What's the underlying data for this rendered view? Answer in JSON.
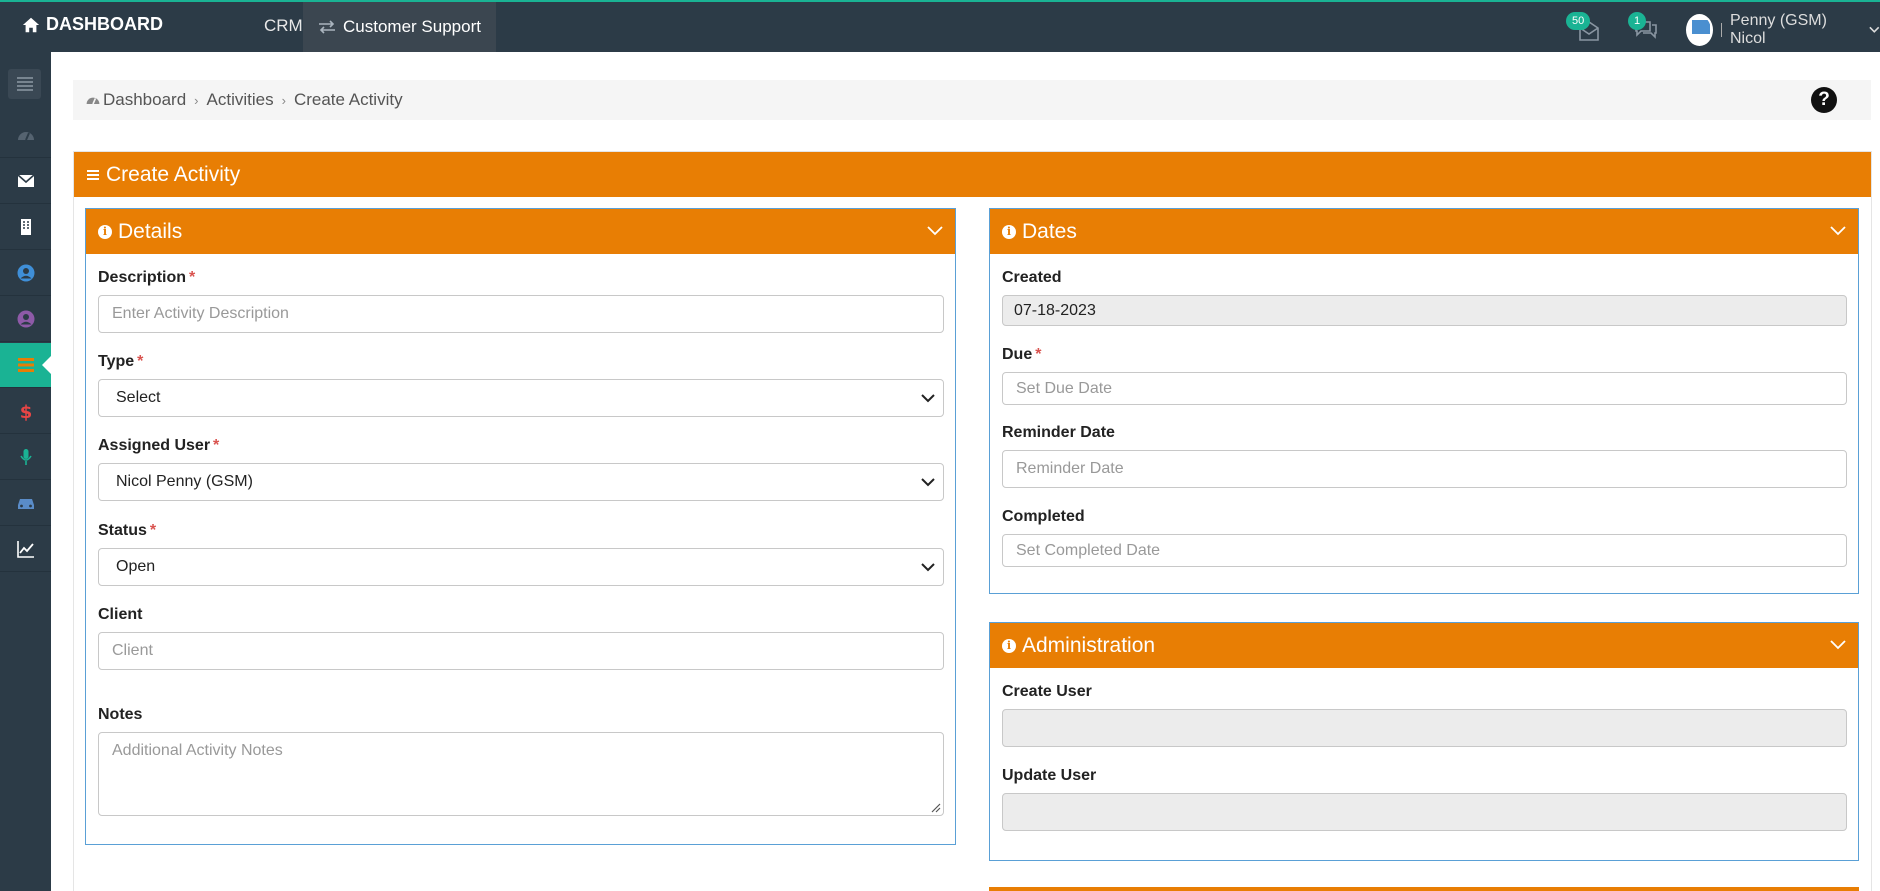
{
  "topbar": {
    "brand": "DASHBOARD",
    "nav_crm": "CRM",
    "nav_support": "Customer Support",
    "mail_badge": "50",
    "chat_badge": "1",
    "user_name": "Penny (GSM) Nicol"
  },
  "sidebar": {
    "icons": [
      "menu-toggle-icon",
      "dashboard-icon",
      "envelope-icon",
      "building-icon",
      "user-circle-icon",
      "user-circle-purple-icon",
      "list-icon",
      "dollar-icon",
      "microphone-icon",
      "car-icon",
      "line-chart-icon"
    ],
    "active": "list-icon"
  },
  "breadcrumb": {
    "items": [
      "Dashboard",
      "Activities",
      "Create Activity"
    ]
  },
  "page": {
    "title": "Create Activity"
  },
  "details": {
    "title": "Details",
    "description_label": "Description",
    "description_placeholder": "Enter Activity Description",
    "type_label": "Type",
    "type_value": "Select",
    "assigned_label": "Assigned User",
    "assigned_value": "Nicol Penny (GSM)",
    "status_label": "Status",
    "status_value": "Open",
    "client_label": "Client",
    "client_placeholder": "Client",
    "notes_label": "Notes",
    "notes_placeholder": "Additional Activity Notes"
  },
  "dates": {
    "title": "Dates",
    "created_label": "Created",
    "created_value": "07-18-2023",
    "due_label": "Due",
    "due_placeholder": "Set Due Date",
    "reminder_label": "Reminder Date",
    "reminder_placeholder": "Reminder Date",
    "completed_label": "Completed",
    "completed_placeholder": "Set Completed Date"
  },
  "administration": {
    "title": "Administration",
    "create_user_label": "Create User",
    "create_user_value": "",
    "update_user_label": "Update User",
    "update_user_value": ""
  },
  "colors": {
    "accent": "#e87e04",
    "topbar": "#2c3b47",
    "active": "#1ab394",
    "required": "#d9534f"
  }
}
